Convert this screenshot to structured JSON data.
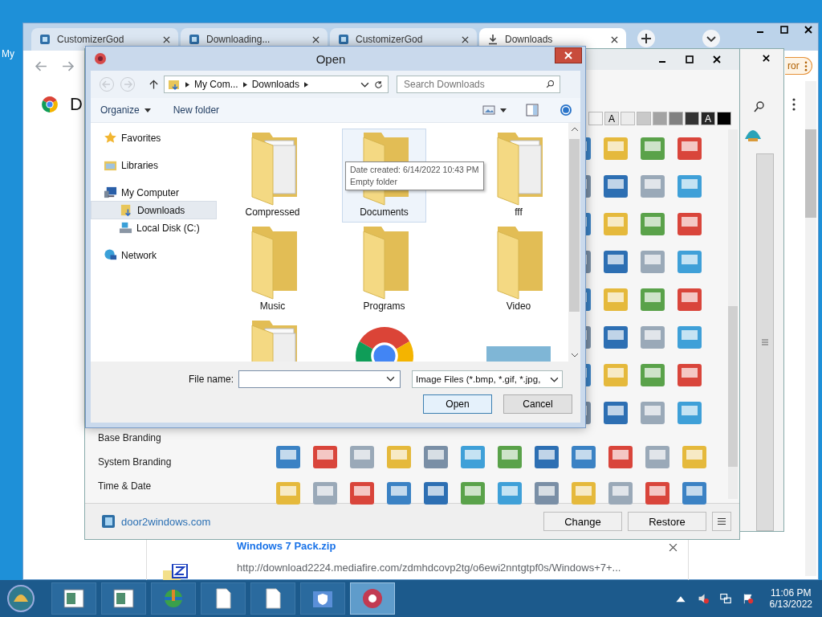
{
  "desktop": {
    "icon_label": "My"
  },
  "browser": {
    "tabs": [
      {
        "label": "CustomizerGod",
        "kind": "app",
        "selected": false
      },
      {
        "label": "Downloading...",
        "kind": "app",
        "selected": false
      },
      {
        "label": "CustomizerGod",
        "kind": "app",
        "selected": false
      },
      {
        "label": "Downloads",
        "kind": "download",
        "selected": true
      }
    ],
    "page_heading": "D",
    "toolbar_button": "ror",
    "download": {
      "filename": "Windows 7 Pack.zip",
      "url": "http://download2224.mediafire.com/zdmhdcovp2tg/o6ewi2nntgtpf0s/Windows+7+..."
    }
  },
  "customizer": {
    "sidebar_items": [
      "Base Branding",
      "System Branding",
      "Time & Date"
    ],
    "swatches": [
      {
        "color": "#f4f4f4"
      },
      {
        "color": "#e2e2e2",
        "label": "A"
      },
      {
        "color": "#ececec"
      },
      {
        "color": "#c9c9c9"
      },
      {
        "color": "#a3a3a3"
      },
      {
        "color": "#818181"
      },
      {
        "color": "#333333"
      },
      {
        "color": "#262626",
        "label": "A"
      },
      {
        "color": "#000000"
      }
    ],
    "footer_link": "door2windows.com",
    "buttons": [
      "Change",
      "Restore"
    ]
  },
  "open_dialog": {
    "title": "Open",
    "breadcrumb": [
      "My Com...",
      "Downloads"
    ],
    "search": {
      "placeholder": "Search Downloads"
    },
    "toolbar": [
      "Organize",
      "New folder"
    ],
    "nav": [
      {
        "label": "Favorites",
        "kind": "favorites",
        "selected": false
      },
      {
        "label": "Libraries",
        "kind": "libraries",
        "selected": false
      },
      {
        "label": "My Computer",
        "kind": "computer",
        "selected": false,
        "children": [
          {
            "label": "Downloads",
            "kind": "downloads",
            "selected": true
          },
          {
            "label": "Local Disk (C:)",
            "kind": "disk",
            "selected": false
          }
        ]
      },
      {
        "label": "Network",
        "kind": "network",
        "selected": false
      }
    ],
    "files": [
      {
        "name": "Compressed",
        "kind": "folder-papers",
        "selected": false
      },
      {
        "name": "Documents",
        "kind": "folder",
        "selected": true
      },
      {
        "name": "fff",
        "kind": "folder-papers",
        "selected": false
      },
      {
        "name": "Music",
        "kind": "folder",
        "selected": false
      },
      {
        "name": "Programs",
        "kind": "folder",
        "selected": false
      },
      {
        "name": "Video",
        "kind": "folder",
        "selected": false
      },
      {
        "kind": "folder-papers",
        "selected": false
      },
      {
        "kind": "chrome",
        "selected": false
      },
      {
        "kind": "photo",
        "selected": false
      }
    ],
    "tooltip": [
      "Date created: 6/14/2022 10:43 PM",
      "Empty folder"
    ],
    "file_name_label": "File name:",
    "file_type": "Image Files (*.bmp, *.gif, *.jpg,",
    "buttons": [
      "Open",
      "Cancel"
    ]
  },
  "taskbar": {
    "buttons": [
      {
        "kind": "window",
        "selected": false
      },
      {
        "kind": "window",
        "selected": false
      },
      {
        "kind": "globe",
        "selected": false
      },
      {
        "kind": "document",
        "selected": false
      },
      {
        "kind": "document",
        "selected": false
      },
      {
        "kind": "shield",
        "selected": false
      },
      {
        "kind": "gear",
        "selected": true
      }
    ],
    "time": "11:06 PM",
    "date": "6/13/2022"
  }
}
